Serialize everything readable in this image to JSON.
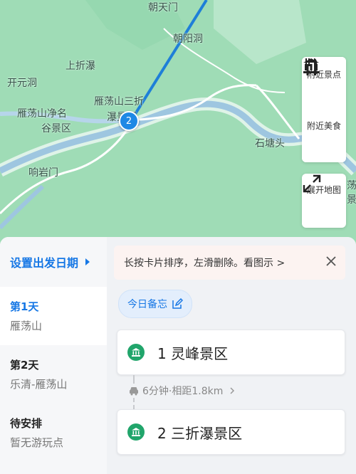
{
  "map": {
    "labels": [
      "朝天门",
      "朝阳洞",
      "上折瀑",
      "开元洞",
      "雁荡山净名",
      "谷景区",
      "雁荡山三折",
      "瀑景区",
      "石塘头",
      "响岩门",
      "荡",
      "景"
    ],
    "pin_number": "2",
    "buttons": {
      "nearby_sights": "附近景点",
      "nearby_food": "附近美食",
      "expand_map": "展开地图"
    }
  },
  "sidebar": {
    "set_date": "设置出发日期",
    "days": [
      {
        "title": "第1天",
        "sub": "雁荡山"
      },
      {
        "title": "第2天",
        "sub": "乐清-雁荡山"
      },
      {
        "title": "待安排",
        "sub": "暂无游玩点"
      }
    ]
  },
  "main": {
    "tip": "长按卡片排序，左滑删除。看图示 >",
    "memo": "今日备忘",
    "spots": [
      {
        "label": "1 灵峰景区"
      },
      {
        "label": "2 三折瀑景区"
      }
    ],
    "distance": "6分钟·相距1.8km"
  },
  "colors": {
    "accent": "#1677e5",
    "spot_icon": "#21a56b",
    "route": "#1e88e5"
  }
}
